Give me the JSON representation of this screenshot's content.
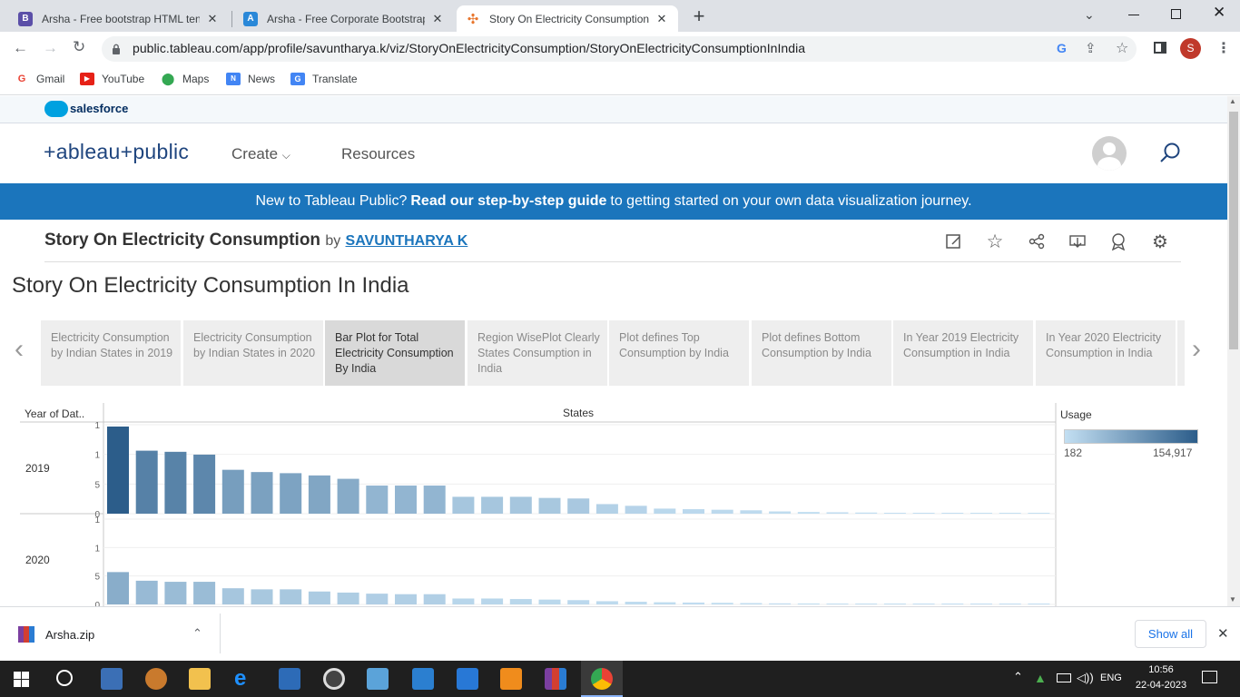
{
  "browser": {
    "tabs": [
      {
        "title": "Arsha - Free bootstrap HTML ten",
        "active": false
      },
      {
        "title": "Arsha - Free Corporate Bootstrap",
        "active": false
      },
      {
        "title": "Story On Electricity Consumption",
        "active": true
      }
    ],
    "new_tab": "+",
    "url": "public.tableau.com/app/profile/savuntharya.k/viz/StoryOnElectricityConsumption/StoryOnElectricityConsumptionInIndia",
    "profile_initial": "S",
    "bookmarks": [
      "Gmail",
      "YouTube",
      "Maps",
      "News",
      "Translate"
    ]
  },
  "salesforce": {
    "label": "salesforce"
  },
  "tableau": {
    "logo": "+ableau+public",
    "nav": {
      "create": "Create",
      "resources": "Resources"
    },
    "banner": {
      "pre": "New to Tableau Public?",
      "link": "Read our step-by-step guide",
      "post": "to getting started on your own data visualization journey."
    },
    "viz_title": "Story On Electricity Consumption",
    "by": "by",
    "author": "SAVUNTHARYA K"
  },
  "story": {
    "title": "Story On Electricity Consumption In India",
    "points": [
      "Electricity Consumption by Indian States in 2019",
      "Electricity Consumption by Indian States in 2020",
      "Bar Plot for Total Electricity Consumption By India",
      "Region WisePlot Clearly States Consumption  in India",
      "Plot defines Top Consumption by India",
      "Plot defines Bottom Consumption by India",
      "In Year 2019 Electricity Consumption in India",
      "In Year 2020 Electricity Consumption in India"
    ],
    "selected_index": 2
  },
  "chart_data": {
    "type": "bar",
    "row_header": "Year of Dat..",
    "column_header": "States",
    "ticks_2019": [
      "1",
      "1",
      "5",
      "0"
    ],
    "ticks_2020": [
      "1",
      "1",
      "5",
      "0"
    ],
    "series": [
      {
        "name": "2019",
        "values": [
          154917,
          112000,
          110000,
          105000,
          78000,
          74000,
          72000,
          68000,
          62000,
          50000,
          50000,
          50000,
          30000,
          30000,
          30000,
          28000,
          27000,
          17000,
          14000,
          9000,
          8000,
          7000,
          6000,
          4000,
          3000,
          2500,
          2000,
          1500,
          1200,
          900,
          600,
          400,
          300
        ]
      },
      {
        "name": "2020",
        "values": [
          60000,
          44000,
          42000,
          42000,
          30000,
          28000,
          28000,
          24000,
          22000,
          20000,
          19000,
          19000,
          11000,
          11000,
          10000,
          9000,
          8000,
          6000,
          5000,
          4000,
          3500,
          3000,
          2500,
          2000,
          1800,
          1500,
          1200,
          1000,
          800,
          600,
          400,
          300,
          182
        ]
      }
    ],
    "legend": {
      "title": "Usage",
      "min_label": "182",
      "max_label": "154,917",
      "min": 182,
      "max": 154917,
      "colors": [
        "#c3dff2",
        "#2c5d8a"
      ]
    }
  },
  "download": {
    "file": "Arsha.zip",
    "show_all": "Show all"
  },
  "taskbar": {
    "lang": "ENG",
    "time": "10:56",
    "date": "22-04-2023"
  }
}
